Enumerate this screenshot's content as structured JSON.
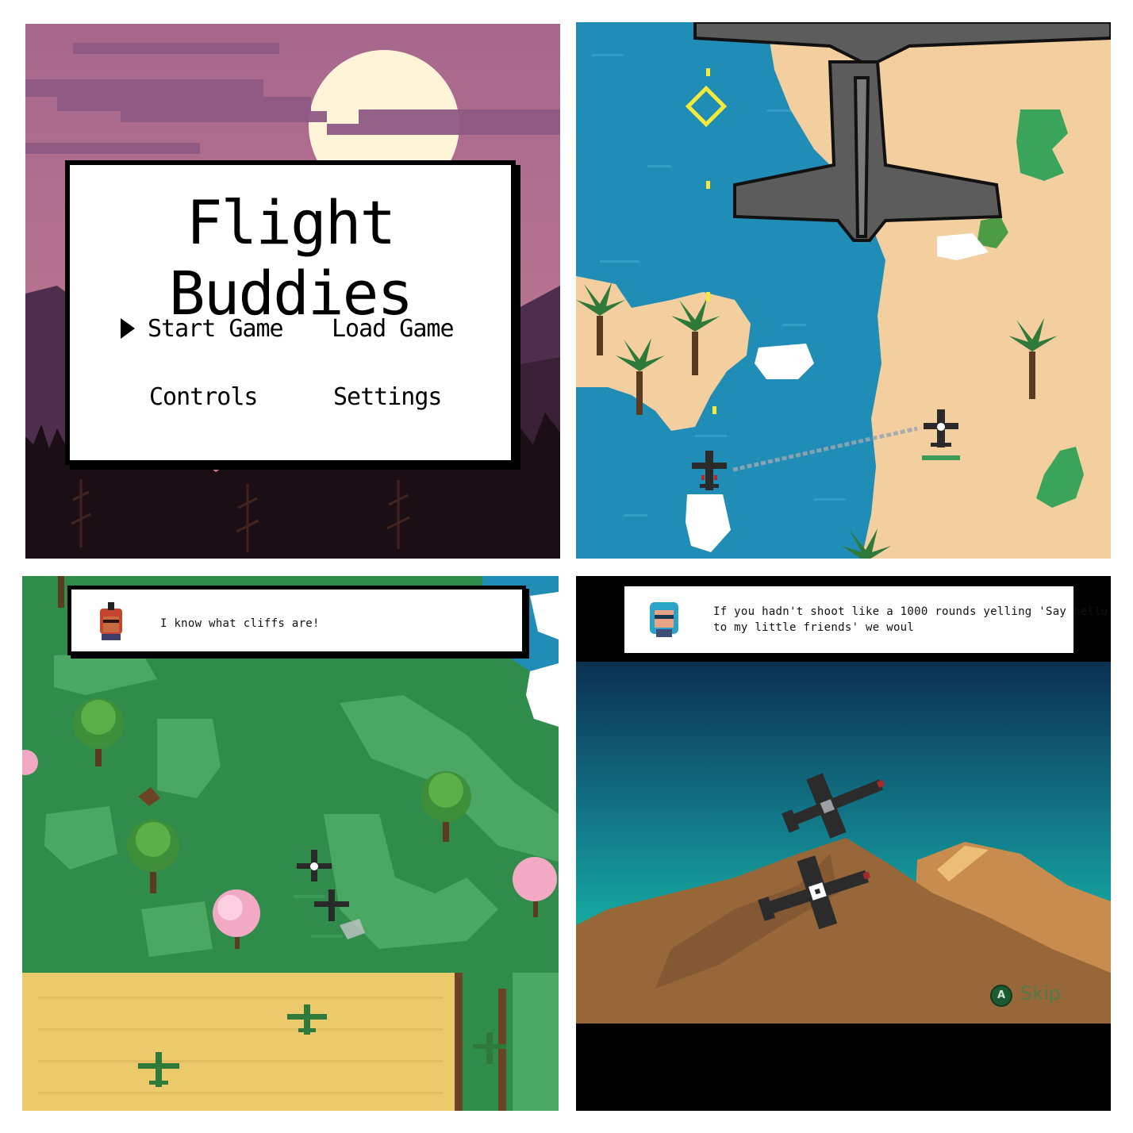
{
  "title_screen": {
    "game_title": "Flight Buddies",
    "menu": {
      "start": "Start Game",
      "load": "Load Game",
      "controls": "Controls",
      "settings": "Settings"
    },
    "selected_item": "Start Game",
    "colors": {
      "sky": "#a86a8a",
      "sun": "#fff6dc",
      "forest": "#1c0f14"
    }
  },
  "scene_coast": {
    "colors": {
      "sea": "#1f8fb8",
      "sand": "#f3cfa0",
      "boss_plane": "#5c5c5c"
    }
  },
  "scene_forest": {
    "dialog": {
      "avatar": "red-helmet-pilot-portrait",
      "text": "I know what cliffs are!"
    },
    "colors": {
      "grass": "#2f8c4a",
      "field": "#ecc96a"
    }
  },
  "scene_mountains": {
    "dialog": {
      "avatar": "blue-haired-pilot-portrait",
      "line1": "If you hadn't shoot like a 1000 rounds yelling 'Say hello",
      "line2": "to my little friends' we woul"
    },
    "skip": {
      "button_glyph": "A",
      "label": "Skip"
    },
    "colors": {
      "sky_top": "#0c3350",
      "sky_bottom": "#15d6b3",
      "mountain": "#97673a"
    }
  }
}
